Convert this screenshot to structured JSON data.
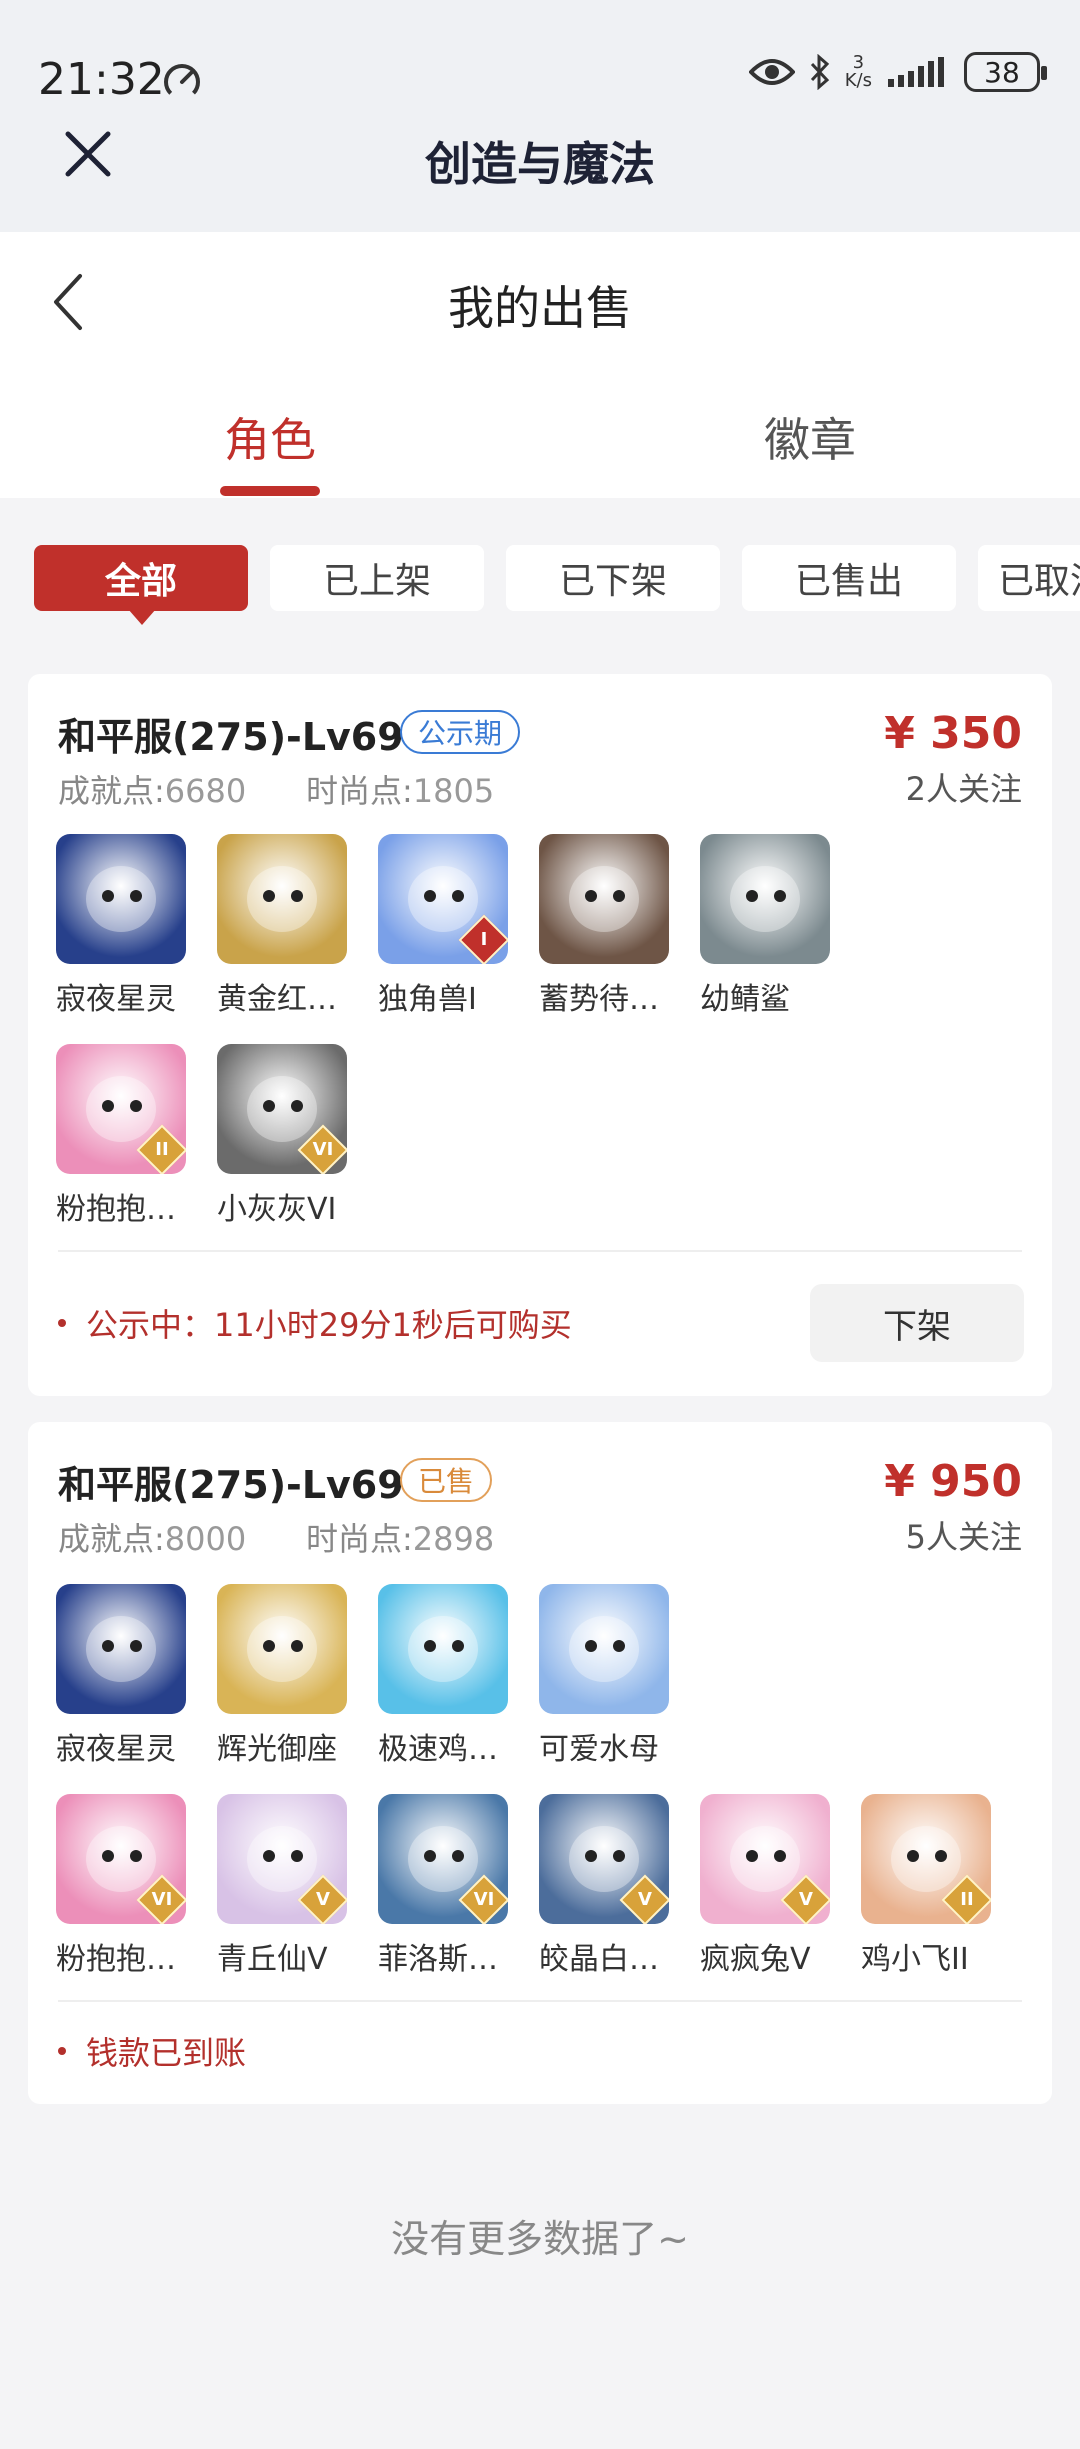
{
  "status_bar": {
    "time": "21:32",
    "net_speed_top": "3",
    "net_speed_unit": "K/s",
    "battery": "38"
  },
  "app_bar": {
    "title": "创造与魔法"
  },
  "page": {
    "title": "我的出售"
  },
  "tabs": [
    {
      "label": "角色",
      "active": true
    },
    {
      "label": "徽章",
      "active": false
    }
  ],
  "filters": [
    {
      "label": "全部",
      "active": true
    },
    {
      "label": "已上架"
    },
    {
      "label": "已下架"
    },
    {
      "label": "已售出"
    },
    {
      "label": "已取消"
    }
  ],
  "orders": [
    {
      "server": "和平服(275)-Lv69",
      "badge": "公示期",
      "price": "¥ 350",
      "watchers": "2人关注",
      "achievement_label": "成就点:",
      "achievement": "6680",
      "fashion_label": "时尚点:",
      "fashion": "1805",
      "items": [
        {
          "name": "寂夜星灵",
          "color": "#27408b",
          "level": ""
        },
        {
          "name": "黄金红…",
          "color": "#c9a34a",
          "level": ""
        },
        {
          "name": "独角兽I",
          "color": "#7aa0e8",
          "level": "I"
        },
        {
          "name": "蓄势待…",
          "color": "#6e5546",
          "level": ""
        },
        {
          "name": "幼鲭鲨",
          "color": "#7c8a8f",
          "level": ""
        },
        {
          "name": "粉抱抱…",
          "color": "#ec8fb9",
          "level": "II"
        },
        {
          "name": "小灰灰VI",
          "color": "#6b6b6b",
          "level": "VI"
        }
      ],
      "status_text": "公示中：11小时29分1秒后可购买",
      "action": "下架"
    },
    {
      "server": "和平服(275)-Lv69",
      "badge": "已售",
      "price": "¥ 950",
      "watchers": "5人关注",
      "achievement_label": "成就点:",
      "achievement": "8000",
      "fashion_label": "时尚点:",
      "fashion": "2898",
      "items": [
        {
          "name": "寂夜星灵",
          "color": "#27408b",
          "level": ""
        },
        {
          "name": "辉光御座",
          "color": "#d9b456",
          "level": ""
        },
        {
          "name": "极速鸡…",
          "color": "#58c0e8",
          "level": ""
        },
        {
          "name": "可爱水母",
          "color": "#8fb6ea",
          "level": ""
        },
        {
          "name": "粉抱抱…",
          "color": "#ec8fb9",
          "level": "VI"
        },
        {
          "name": "青丘仙V",
          "color": "#d8c2e6",
          "level": "V"
        },
        {
          "name": "菲洛斯…",
          "color": "#4a78a8",
          "level": "VI"
        },
        {
          "name": "皎晶白…",
          "color": "#4c6d9b",
          "level": "V"
        },
        {
          "name": "疯疯兔V",
          "color": "#f0b0cf",
          "level": "V"
        },
        {
          "name": "鸡小飞II",
          "color": "#e9b28f",
          "level": "II"
        }
      ],
      "status_text": "钱款已到账"
    }
  ],
  "footer": {
    "no_more": "没有更多数据了~"
  }
}
